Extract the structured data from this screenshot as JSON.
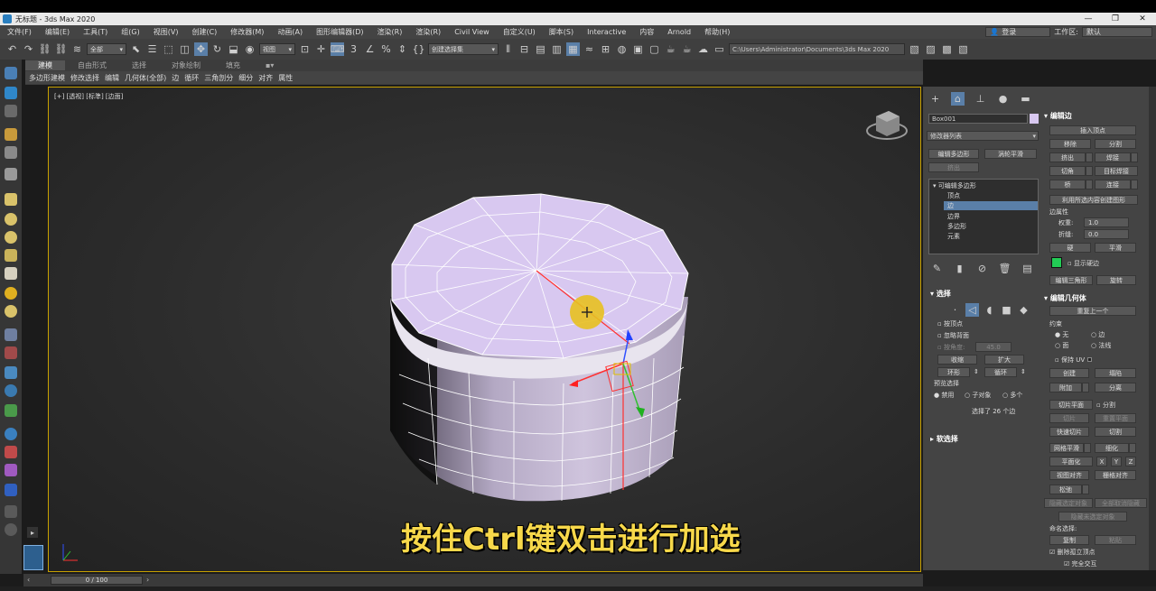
{
  "titlebar": {
    "title": "无标题 - 3ds Max 2020",
    "minimize": "—",
    "restore": "❐",
    "close": "✕"
  },
  "menubar": {
    "items": [
      "文件(F)",
      "编辑(E)",
      "工具(T)",
      "组(G)",
      "视图(V)",
      "创建(C)",
      "修改器(M)",
      "动画(A)",
      "图形编辑器(D)",
      "渲染(R)",
      "渲染(R)",
      "Civil View",
      "自定义(U)",
      "脚本(S)",
      "Interactive",
      "内容",
      "Arnold",
      "帮助(H)"
    ],
    "login": "登录",
    "workspace_label": "工作区:",
    "workspace_value": "默认"
  },
  "toolbar": {
    "selection_filter": "全部",
    "view_dropdown": "视图",
    "selection_set": "创建选择集",
    "path": "C:\\Users\\Administrator\\Documents\\3ds Max 2020"
  },
  "ribbon": {
    "tabs": [
      "建模",
      "自由形式",
      "选择",
      "对象绘制",
      "填充"
    ],
    "subitems": [
      "多边形建模",
      "修改选择",
      "编辑",
      "几何体(全部)",
      "边",
      "循环",
      "三角剖分",
      "细分",
      "对齐",
      "属性"
    ]
  },
  "viewport": {
    "label": "[+] [透视] [标準] [边面]",
    "subtitle": "按住Ctrl键双击进行加选"
  },
  "command_panel": {
    "object_name": "Box001",
    "modifier_list": "修改器列表",
    "btn_edit_poly": "编辑多边形",
    "btn_turbosmooth": "涡轮平滑",
    "btn_extrude": "挤出",
    "stack_root": "可编辑多边形",
    "stack_items": [
      "顶点",
      "边",
      "边界",
      "多边形",
      "元素"
    ],
    "selection_header": "选择",
    "by_vertex": "按顶点",
    "ignore_backface": "忽略背面",
    "by_angle": "按角度:",
    "by_angle_value": "45.0",
    "shrink": "收缩",
    "grow": "扩大",
    "ring": "环形",
    "loop": "循环",
    "preview_selection": "预览选择",
    "disabled": "禁用",
    "sub_object": "子对象",
    "multi": "多个",
    "selection_status": "选择了 26 个边",
    "soft_selection": "软选择"
  },
  "modify_panel": {
    "edit_edges_header": "编辑边",
    "insert_vertex": "插入顶点",
    "remove": "移除",
    "split": "分割",
    "extrude": "挤出",
    "weld": "焊接",
    "chamfer": "切角",
    "target_weld": "目标焊接",
    "bridge": "桥",
    "connect": "连接",
    "create_shape": "利用所选内容创建图形",
    "edge_props": "边属性",
    "weight": "权重:",
    "weight_value": "1.0",
    "crease": "折缝:",
    "crease_value": "0.0",
    "hard": "硬",
    "smooth": "平滑",
    "display_hard_edges": "显示硬边",
    "edit_tri": "编辑三角形",
    "turn": "旋转",
    "edit_geometry_header": "编辑几何体",
    "repeat_last": "重复上一个",
    "constraints": "约束",
    "none": "无",
    "edge": "边",
    "face": "面",
    "normal": "法线",
    "preserve_uvs": "保持 UV",
    "create": "创建",
    "collapse": "塌陷",
    "attach": "附加",
    "detach": "分离",
    "slice_plane": "切片平面",
    "split2": "分割",
    "slice": "切片",
    "reset_plane": "重置平面",
    "quickslice": "快速切片",
    "cut": "切割",
    "meshsmooth": "网格平滑",
    "tessellate": "细化",
    "make_planar": "平面化",
    "x": "X",
    "y": "Y",
    "z": "Z",
    "view_align": "视图对齐",
    "grid_align": "栅格对齐",
    "relax": "松弛",
    "hide_selected": "隐藏选定对象",
    "unhide_all": "全部取消隐藏",
    "hide_unselected": "隐藏未选定对象",
    "named_selections": "命名选择:",
    "copy": "复制",
    "paste": "粘贴",
    "delete_isolated": "删除孤立顶点",
    "full_interactivity": "完全交互"
  },
  "timebar": {
    "frame": "0 / 100"
  },
  "colors": {
    "accent": "#5a7fa8",
    "subtitle": "#f7d84a",
    "viewport_border": "#c7a000",
    "object_color": "#d8c8f0"
  }
}
